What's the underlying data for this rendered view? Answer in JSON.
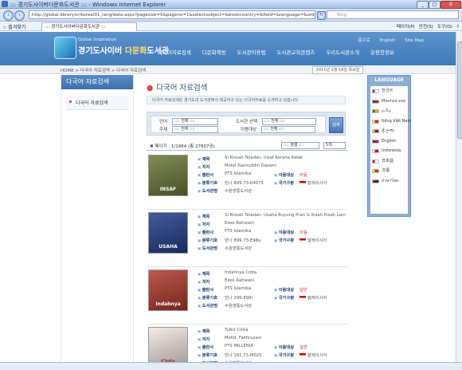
{
  "window": {
    "title": "::: 경기도사이버다문화도서관 ::: - Windows Internet Explorer",
    "minimize": "_",
    "maximize": "□",
    "close": "X"
  },
  "browser": {
    "back_icon": "back-arrow-icon",
    "forward_icon": "forward-arrow-icon",
    "url": "http://global.library.kr/korea/01_lang/data.aspx?pagesize=5&pageno=1&selectsubject=&bookcountry=&field=&language=&orderby=&code=2&searchtype=",
    "search_placeholder": "Bing",
    "favorites_label": "즐겨찾기",
    "tab_title": "::: 경기도사이버다문화도서관 :::",
    "command_items": [
      "페이지(P)",
      "안전(S)",
      "도구(O)",
      "?"
    ]
  },
  "site": {
    "brand_small": "Global Inspiration",
    "brand_main_a": "경기도사이버 ",
    "brand_main_b": "다문화",
    "brand_main_c": "도서관",
    "top_links": [
      "홈으로",
      "English",
      "Site Map"
    ],
    "nav": [
      "다국어자료검색",
      "다문화책방",
      "도서관이용법",
      "도서관교육콘텐츠",
      "우리도서관소개",
      "유용한정보"
    ],
    "breadcrumb": "HOME > 다국어 자료검색 > 다국어 자료검색",
    "date": "2011년 1월 19일 목요일"
  },
  "sidebar": {
    "heading": "다국어 자료검색",
    "items": [
      "다국어 자료검색"
    ]
  },
  "main": {
    "title": "다국어 자료검색",
    "description": "다국어 자료검색은 경기도내 도서관에서 제공하고 있는 다국어자료를 소개하고 있습니다.",
    "search": {
      "language_label": "언어",
      "language_value": ":::: 전체 ::::",
      "subject_label": "주제",
      "subject_value": ":::: 전체 ::::",
      "library_label": "도서관 선택",
      "library_value": ":::: 전체 ::::",
      "audience_label": "이용대상",
      "audience_value": ":::: 전체 ::::",
      "button": "검색"
    },
    "results": {
      "summary": "페이지 : 1/1964 (총 27807권)",
      "sort_value": ":::: 정렬 ::::",
      "page_size": "5개"
    }
  },
  "books": [
    {
      "cover_text": "INSAF",
      "cover_color": "#6d7a3a",
      "title": "Si Kissah Teladan: Insaf Kerana Kalak",
      "author": "Mohd Kasnuddin Daswni",
      "publisher": "PTS Islamika",
      "audience_label": "이용대상",
      "audience": "아동",
      "classification": "만나 899.73-K4075",
      "country_label": "국가구분",
      "country": "말레이시아",
      "library": "수원영통도서관"
    },
    {
      "cover_text": "USAHA",
      "cover_color": "#243f8a",
      "title": "Si Kissah Teladan: Usaha Buyung Prati & Kisah-Kisah Lain",
      "author": "Ezee Rahwani",
      "publisher": "PTS Islamika",
      "audience_label": "이용대상",
      "audience": "아동",
      "classification": "만나 899.73-E98u",
      "country_label": "국가구분",
      "country": "말레이시아",
      "library": "수원영통도서관"
    },
    {
      "cover_text": "Indahnya",
      "cover_color": "#b23b2c",
      "title": "Indahnya Cinta",
      "author": "Ezee Rahwani",
      "publisher": "PTS Islamika",
      "audience_label": "이용대상",
      "audience": "일반",
      "classification": "만나 299-E98i",
      "country_label": "국가구분",
      "country": "말레이시아",
      "library": "수원영통도서관"
    },
    {
      "cover_text": "Cinta",
      "cover_color": "#f2e8e4",
      "title": "Tulkir Cinta",
      "author": "Mohd. Fakhruzazi",
      "publisher": "PTS MILLENIA",
      "audience_label": "이용대상",
      "audience": "일반",
      "classification": "만나 181.73-M025",
      "country_label": "국가구분",
      "country": "말레이시아",
      "library": "수원영통도서관"
    }
  ],
  "labels": {
    "title": "제목",
    "author": "저자",
    "publisher": "출판사",
    "classification": "분류기호",
    "library": "도서관명"
  },
  "language_box": {
    "heading": "LANGUAGE",
    "items": [
      {
        "name": "한국어",
        "color": "#ffffff",
        "accent": "#c8102e"
      },
      {
        "name": "Монгол хэл",
        "color": "#c4272f",
        "accent": "#015197"
      },
      {
        "name": "தமிழ்",
        "color": "#ff9933",
        "accent": "#138808"
      },
      {
        "name": "tiếng Việt Nam",
        "color": "#da251d",
        "accent": "#ffff00"
      },
      {
        "name": "ශ්‍රී ලංකා",
        "color": "#8d153a",
        "accent": "#ffbe29"
      },
      {
        "name": "English",
        "color": "#b22234",
        "accent": "#3c3b6e"
      },
      {
        "name": "Indonesia",
        "color": "#ce1126",
        "accent": "#ffffff"
      },
      {
        "name": "日本語",
        "color": "#ffffff",
        "accent": "#bc002d"
      },
      {
        "name": "汉语",
        "color": "#de2910",
        "accent": "#ffde00"
      },
      {
        "name": "ภาษาไทย",
        "color": "#2d2a4a",
        "accent": "#a51931"
      }
    ]
  }
}
